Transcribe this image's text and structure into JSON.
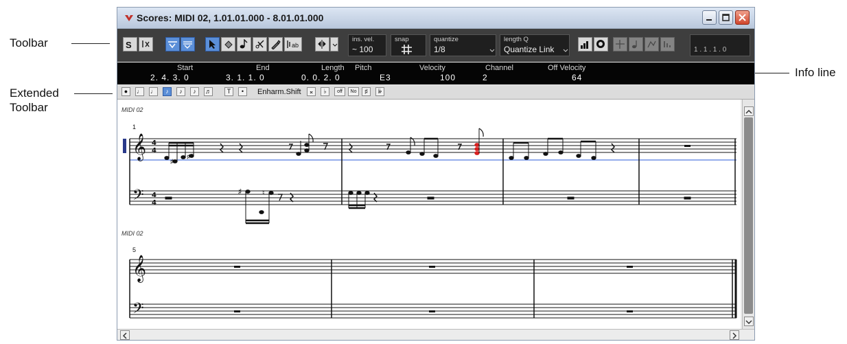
{
  "callouts": {
    "toolbar": "Toolbar",
    "extended_toolbar_1": "Extended",
    "extended_toolbar_2": "Toolbar",
    "info_line": "Info line"
  },
  "window": {
    "title": "Scores: MIDI 02, 1.01.01.000 - 8.01.01.000"
  },
  "toolbar": {
    "ins_vel": {
      "label": "ins. vel.",
      "value": "100"
    },
    "snap": {
      "label": "snap"
    },
    "quantize": {
      "label": "quantize",
      "value": "1/8"
    },
    "length_q": {
      "label": "length Q",
      "value": "Quantize Link"
    },
    "position": "1 . 1 . 1 .   0"
  },
  "infoline": {
    "start": {
      "label": "Start",
      "value": "2. 4. 3.   0"
    },
    "end": {
      "label": "End",
      "value": "3. 1. 1.   0"
    },
    "length": {
      "label": "Length",
      "value": "0. 0. 2.   0"
    },
    "pitch": {
      "label": "Pitch",
      "value": "E3"
    },
    "velocity": {
      "label": "Velocity",
      "value": "100"
    },
    "channel": {
      "label": "Channel",
      "value": "2"
    },
    "off_velocity": {
      "label": "Off Velocity",
      "value": "64"
    }
  },
  "ext_toolbar": {
    "enharm_label": "Enharm.Shift",
    "buttons": [
      "●",
      "♩",
      "♩",
      "♪",
      "♪",
      "♪",
      "♬",
      "T",
      "•"
    ],
    "enharm_buttons": [
      "𝄪",
      "♭",
      "off",
      "No",
      "♯",
      "𝄫"
    ]
  },
  "score": {
    "system1_label": "MIDI 02",
    "system2_label": "MIDI 02",
    "bar1": "1",
    "bar5": "5",
    "time_sig": "4"
  },
  "colors": {
    "toolbar_bg": "#3e3e3e",
    "infoline_bg": "#050505",
    "accent_blue": "#5b8fd8",
    "selected_note": "#d62020",
    "close_button": "#d0452c"
  }
}
